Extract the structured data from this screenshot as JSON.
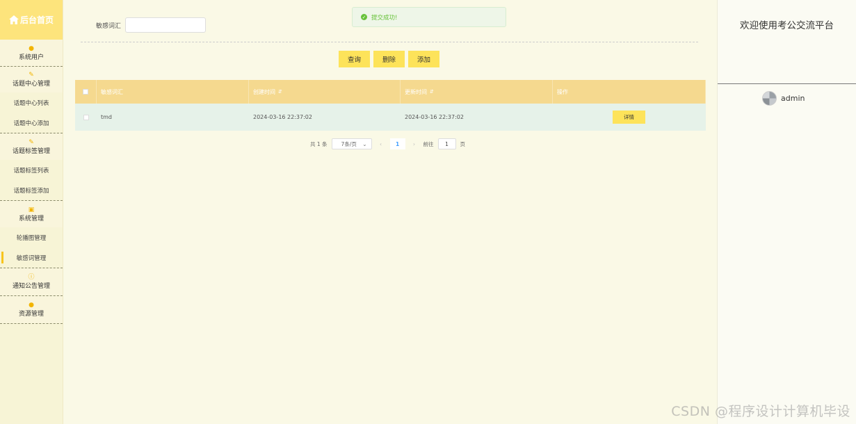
{
  "sidebar": {
    "home": "后台首页",
    "groups": [
      {
        "icon": "user-icon",
        "label": "系统用户",
        "subs": []
      },
      {
        "icon": "edit-icon",
        "label": "话题中心管理",
        "subs": [
          "话题中心列表",
          "话题中心添加"
        ]
      },
      {
        "icon": "edit-icon",
        "label": "话题标签管理",
        "subs": [
          "话题标签列表",
          "话题标签添加"
        ]
      },
      {
        "icon": "image-icon",
        "label": "系统管理",
        "subs": [
          "轮播图管理",
          "敏感词管理"
        ]
      },
      {
        "icon": "warning-icon",
        "label": "通知公告管理",
        "subs": []
      },
      {
        "icon": "location-icon",
        "label": "资源管理",
        "subs": []
      }
    ],
    "active_sub": "敏感词管理"
  },
  "search": {
    "label": "敏感词汇",
    "value": ""
  },
  "toast": {
    "text": "提交成功!"
  },
  "buttons": {
    "query": "查询",
    "delete": "删除",
    "add": "添加"
  },
  "table": {
    "headers": [
      "敏感词汇",
      "创建时间",
      "更新时间",
      "操作"
    ],
    "rows": [
      {
        "word": "tmd",
        "created": "2024-03-16 22:37:02",
        "updated": "2024-03-16 22:37:02",
        "action": "详情"
      }
    ]
  },
  "pager": {
    "total": "共 1 条",
    "page_size": "7条/页",
    "current": "1",
    "goto_label": "前往",
    "goto_value": "1",
    "page_suffix": "页"
  },
  "right": {
    "welcome": "欢迎使用考公交流平台",
    "username": "admin"
  },
  "watermark": "CSDN @程序设计计算机毕设",
  "colors": {
    "accent": "#fde35a",
    "header": "#f5d98f",
    "success": "#67c23a"
  }
}
